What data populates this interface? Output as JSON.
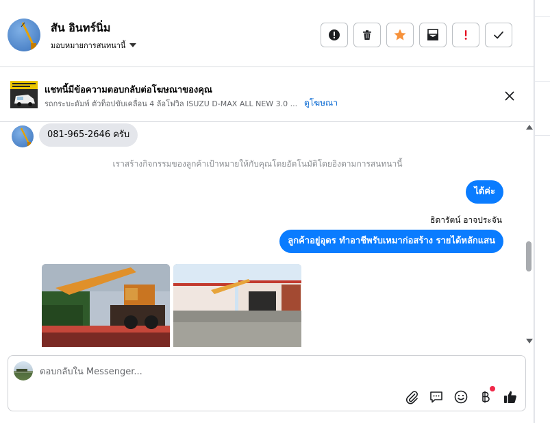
{
  "header": {
    "contact_name": "สัน อินทร์นิ่ม",
    "assign_label": "มอบหมายการสนทนานี้",
    "actions": [
      {
        "name": "mark-spam",
        "icon": "exclamation-circle-icon"
      },
      {
        "name": "delete",
        "icon": "trash-icon"
      },
      {
        "name": "star",
        "icon": "star-icon",
        "color": "#f7923b"
      },
      {
        "name": "mark-unread",
        "icon": "envelope-icon"
      },
      {
        "name": "follow-up",
        "icon": "exclamation-icon",
        "color": "#e4001b"
      },
      {
        "name": "done",
        "icon": "check-icon"
      }
    ]
  },
  "ad": {
    "title": "แชทนี้มีข้อความตอบกลับต่อโฆษณาของคุณ",
    "description": "รถกระบะดัมพ์ ตัวท็อปขับเคลื่อน 4 ล้อโฟวิล ISUZU D-MAX ALL NEW 3.0 ...",
    "link_label": "ดูโฆษณา"
  },
  "messages": {
    "incoming_text": "081-965-2646 ครับ",
    "system_note": "เราสร้างกิจกรรมของลูกค้าเป้าหมายให้กับคุณโดยอัตโนมัติโดยอิงตามการสนทนานี้",
    "outgoing_1": "ได้ค่ะ",
    "sender_name": "ธิดารัตน์ อาจประจัน",
    "outgoing_2": "ลูกค้าอยู่อุดร ทำอาชีพรับเหมาก่อสร้าง รายได้หลักแสน"
  },
  "composer": {
    "placeholder": "ตอบกลับใน Messenger...",
    "tools": [
      "attachment-icon",
      "saved-reply-icon",
      "emoji-icon",
      "baht-payment-icon",
      "thumbs-up-icon"
    ]
  },
  "colors": {
    "accent": "#0a7cff",
    "link": "#0064d1",
    "incoming_bubble": "#e4e6eb",
    "notification_dot": "#f02849"
  }
}
